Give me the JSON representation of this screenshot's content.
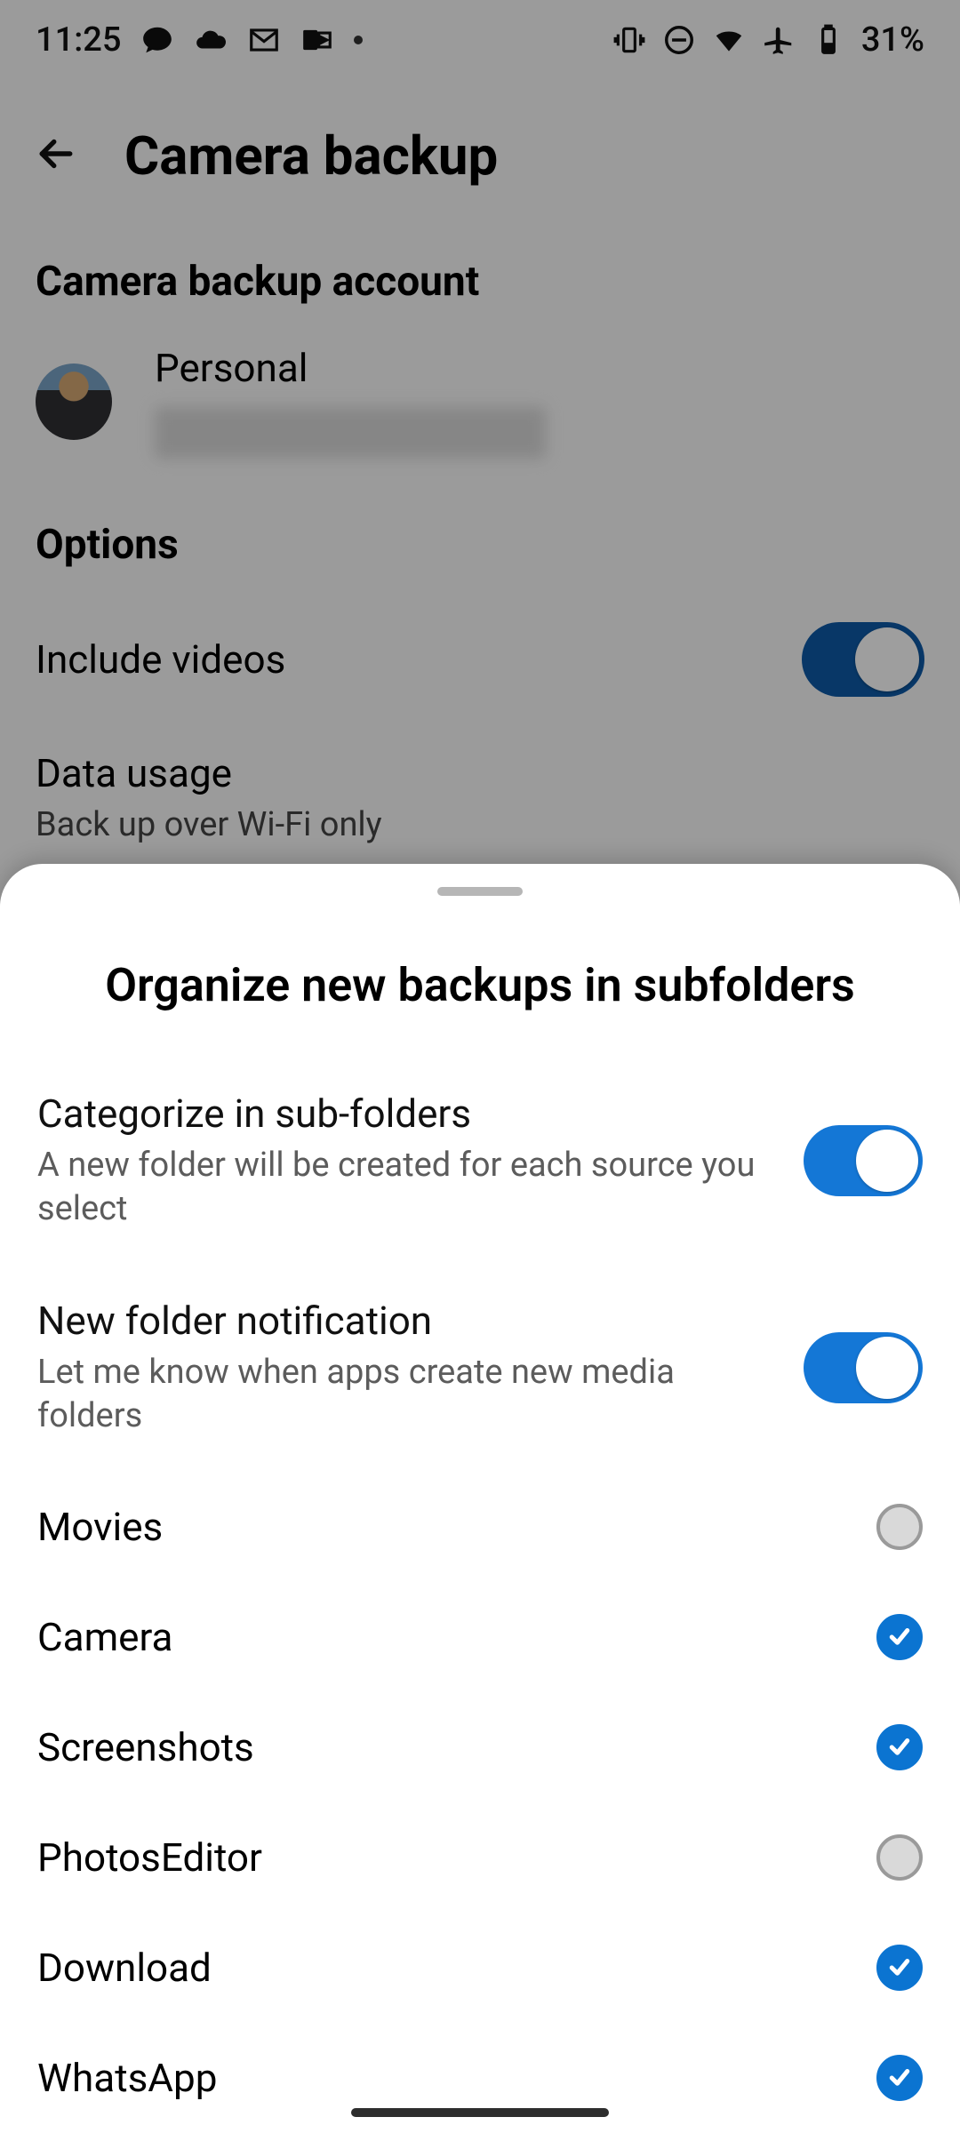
{
  "status": {
    "time": "11:25",
    "battery_text": "31%"
  },
  "header": {
    "title": "Camera backup"
  },
  "sections": {
    "account_title": "Camera backup account",
    "account_label": "Personal",
    "options_title": "Options",
    "include_videos_label": "Include videos",
    "data_usage_title": "Data usage",
    "data_usage_sub": "Back up over Wi-Fi only"
  },
  "sheet": {
    "title": "Organize new backups in subfolders",
    "categorize": {
      "title": "Categorize in sub-folders",
      "sub": "A new folder will be created for each source you select"
    },
    "notify": {
      "title": "New folder notification",
      "sub": "Let me know when apps create new media folders"
    },
    "folders": {
      "0": {
        "name": "Movies"
      },
      "1": {
        "name": "Camera"
      },
      "2": {
        "name": "Screenshots"
      },
      "3": {
        "name": "PhotosEditor"
      },
      "4": {
        "name": "Download"
      },
      "5": {
        "name": "WhatsApp"
      }
    }
  }
}
